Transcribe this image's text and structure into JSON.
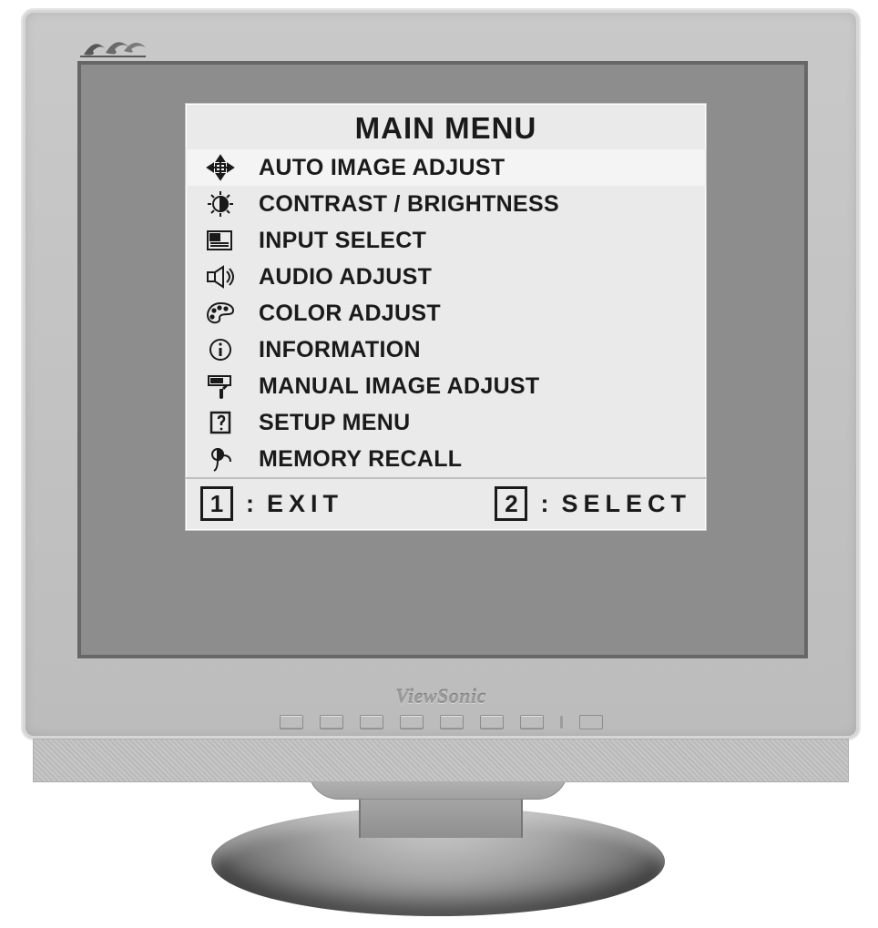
{
  "brand": "ViewSonic",
  "osd": {
    "title": "MAIN MENU",
    "items": [
      {
        "icon": "auto-adjust-icon",
        "label": "AUTO IMAGE ADJUST",
        "selected": true
      },
      {
        "icon": "brightness-icon",
        "label": "CONTRAST / BRIGHTNESS",
        "selected": false
      },
      {
        "icon": "input-select-icon",
        "label": "INPUT SELECT",
        "selected": false
      },
      {
        "icon": "audio-icon",
        "label": "AUDIO ADJUST",
        "selected": false
      },
      {
        "icon": "palette-icon",
        "label": "COLOR ADJUST",
        "selected": false
      },
      {
        "icon": "info-icon",
        "label": "INFORMATION",
        "selected": false
      },
      {
        "icon": "manual-adjust-icon",
        "label": "MANUAL IMAGE ADJUST",
        "selected": false
      },
      {
        "icon": "setup-icon",
        "label": "SETUP MENU",
        "selected": false
      },
      {
        "icon": "recall-icon",
        "label": "MEMORY RECALL",
        "selected": false
      }
    ],
    "footer": {
      "key1": "1",
      "action1": "EXIT",
      "key2": "2",
      "action2": "SELECT"
    }
  }
}
